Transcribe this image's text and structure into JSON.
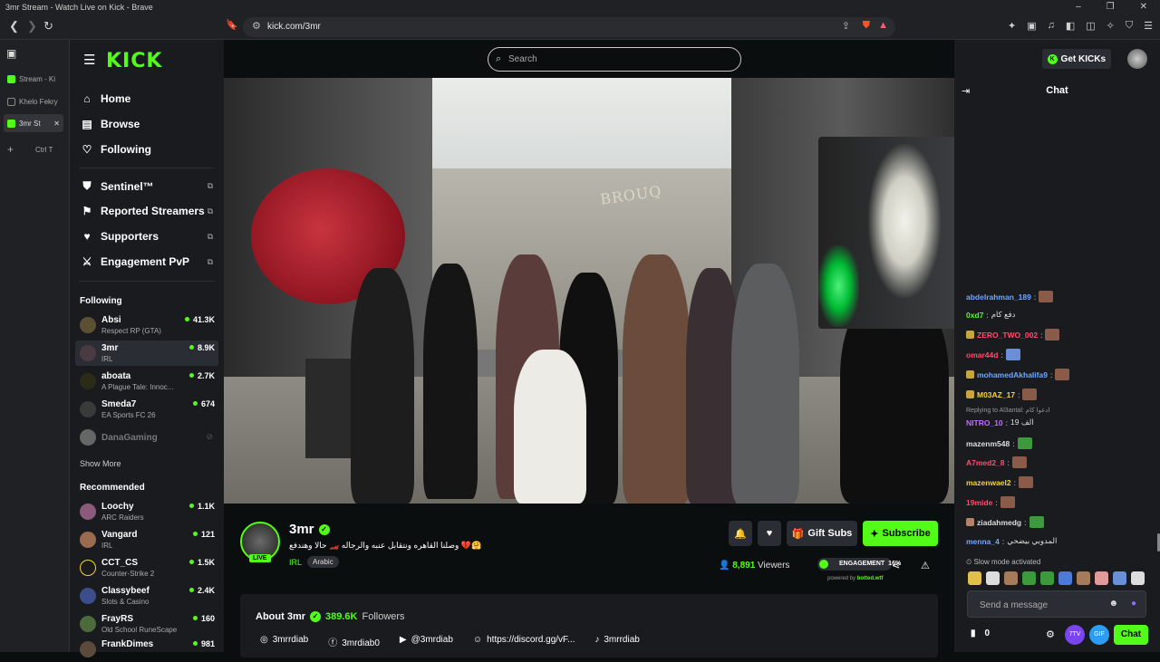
{
  "window": {
    "title": "3mr Stream - Watch Live on Kick - Brave"
  },
  "browser": {
    "url": "kick.com/3mr"
  },
  "tabs": [
    {
      "label": "Stream - Ki"
    },
    {
      "label": "Khelo Fekry"
    },
    {
      "label": "3mr St"
    }
  ],
  "newtab_hint": "Ctrl T",
  "sidebar": {
    "brand": "KICK",
    "nav": [
      {
        "label": "Home",
        "icon": "home-icon"
      },
      {
        "label": "Browse",
        "icon": "browse-icon"
      },
      {
        "label": "Following",
        "icon": "heart-icon"
      }
    ],
    "extras": [
      {
        "label": "Sentinel™",
        "icon": "shield-icon"
      },
      {
        "label": "Reported Streamers",
        "icon": "flag-icon"
      },
      {
        "label": "Supporters",
        "icon": "heart-icon"
      },
      {
        "label": "Engagement PvP",
        "icon": "swords-icon"
      }
    ],
    "following_title": "Following",
    "following": [
      {
        "name": "Absi",
        "category": "Respect RP (GTA)",
        "viewers": "41.3K"
      },
      {
        "name": "3mr",
        "category": "IRL",
        "viewers": "8.9K"
      },
      {
        "name": "aboata",
        "category": "A Plague Tale: Innoc...",
        "viewers": "2.7K"
      },
      {
        "name": "Smeda7",
        "category": "EA Sports FC 26",
        "viewers": "674"
      },
      {
        "name": "DanaGaming",
        "category": "",
        "viewers": ""
      }
    ],
    "show_more": "Show More",
    "recommended_title": "Recommended",
    "recommended": [
      {
        "name": "Loochy",
        "category": "ARC Raiders",
        "viewers": "1.1K"
      },
      {
        "name": "Vangard",
        "category": "IRL",
        "viewers": "121"
      },
      {
        "name": "CCT_CS",
        "category": "Counter-Strike 2",
        "viewers": "1.5K"
      },
      {
        "name": "Classybeef",
        "category": "Slots & Casino",
        "viewers": "2.4K"
      },
      {
        "name": "FrayRS",
        "category": "Old School RuneScape",
        "viewers": "160"
      },
      {
        "name": "FrankDimes",
        "category": "",
        "viewers": "981"
      }
    ]
  },
  "search": {
    "placeholder": "Search"
  },
  "video": {
    "sign_text": "BROUQ"
  },
  "stream": {
    "name": "3mr",
    "live": "LIVE",
    "title": "وصلنا القاهره ونتقابل عنبه والرجاله 🏎️ حالا وهندفع 💔🤗",
    "category": "IRL",
    "tag": "Arabic",
    "viewers": "8,891",
    "viewers_label": "Viewers",
    "engagement_label": "ENGAGEMENT",
    "engagement_value": "16%",
    "powered": "powered by",
    "powered_brand": "botted.wtf",
    "gift_label": "Gift Subs",
    "subscribe_label": "Subscribe"
  },
  "about": {
    "title": "About 3mr",
    "followers": "389.6K",
    "followers_label": "Followers",
    "socials": [
      {
        "icon": "instagram-icon",
        "label": "3mrrdiab"
      },
      {
        "icon": "facebook-icon",
        "label": "3mrdiab0"
      },
      {
        "icon": "youtube-icon",
        "label": "@3mrdiab"
      },
      {
        "icon": "discord-icon",
        "label": "https://discord.gg/vF..."
      },
      {
        "icon": "tiktok-icon",
        "label": "3mrrdiab"
      }
    ]
  },
  "header": {
    "get_kicks": "Get KICKs"
  },
  "chat": {
    "title": "Chat",
    "messages": [
      {
        "user": "abdelrahman_189",
        "color": "#6fa8ff",
        "text": ""
      },
      {
        "user": "0xd7",
        "color": "#53fc18",
        "text": "دفع كام"
      },
      {
        "user": "ZERO_TWO_002",
        "color": "#ff4d6d",
        "text": ""
      },
      {
        "user": "omar44d",
        "color": "#ff4d6d",
        "text": ""
      },
      {
        "user": "mohamedAkhalifa9",
        "color": "#6fa8ff",
        "text": ""
      },
      {
        "user": "M03AZ_17",
        "color": "#f2d33d",
        "text": ""
      },
      {
        "user": "NITRO_10",
        "color": "#c06cff",
        "text": "الف 19"
      },
      {
        "user": "mazenm548",
        "color": "#ddd",
        "text": ""
      },
      {
        "user": "A7med2_8",
        "color": "#ff4d6d",
        "text": ""
      },
      {
        "user": "mazenwael2",
        "color": "#f2d33d",
        "text": ""
      },
      {
        "user": "19mide",
        "color": "#ff4d6d",
        "text": ""
      },
      {
        "user": "ziadahmedg",
        "color": "#ddd",
        "text": ""
      },
      {
        "user": "menna_4",
        "color": "#6fa8ff",
        "text": "المدوبي بيضحي"
      }
    ],
    "reply_note": "Replying to Al3antal: ادعوا كام",
    "slow_mode": "Slow mode activated",
    "placeholder": "Send a message",
    "kicks_count": "0",
    "seventv": "7TV",
    "gif": "GIF",
    "send_label": "Chat"
  }
}
